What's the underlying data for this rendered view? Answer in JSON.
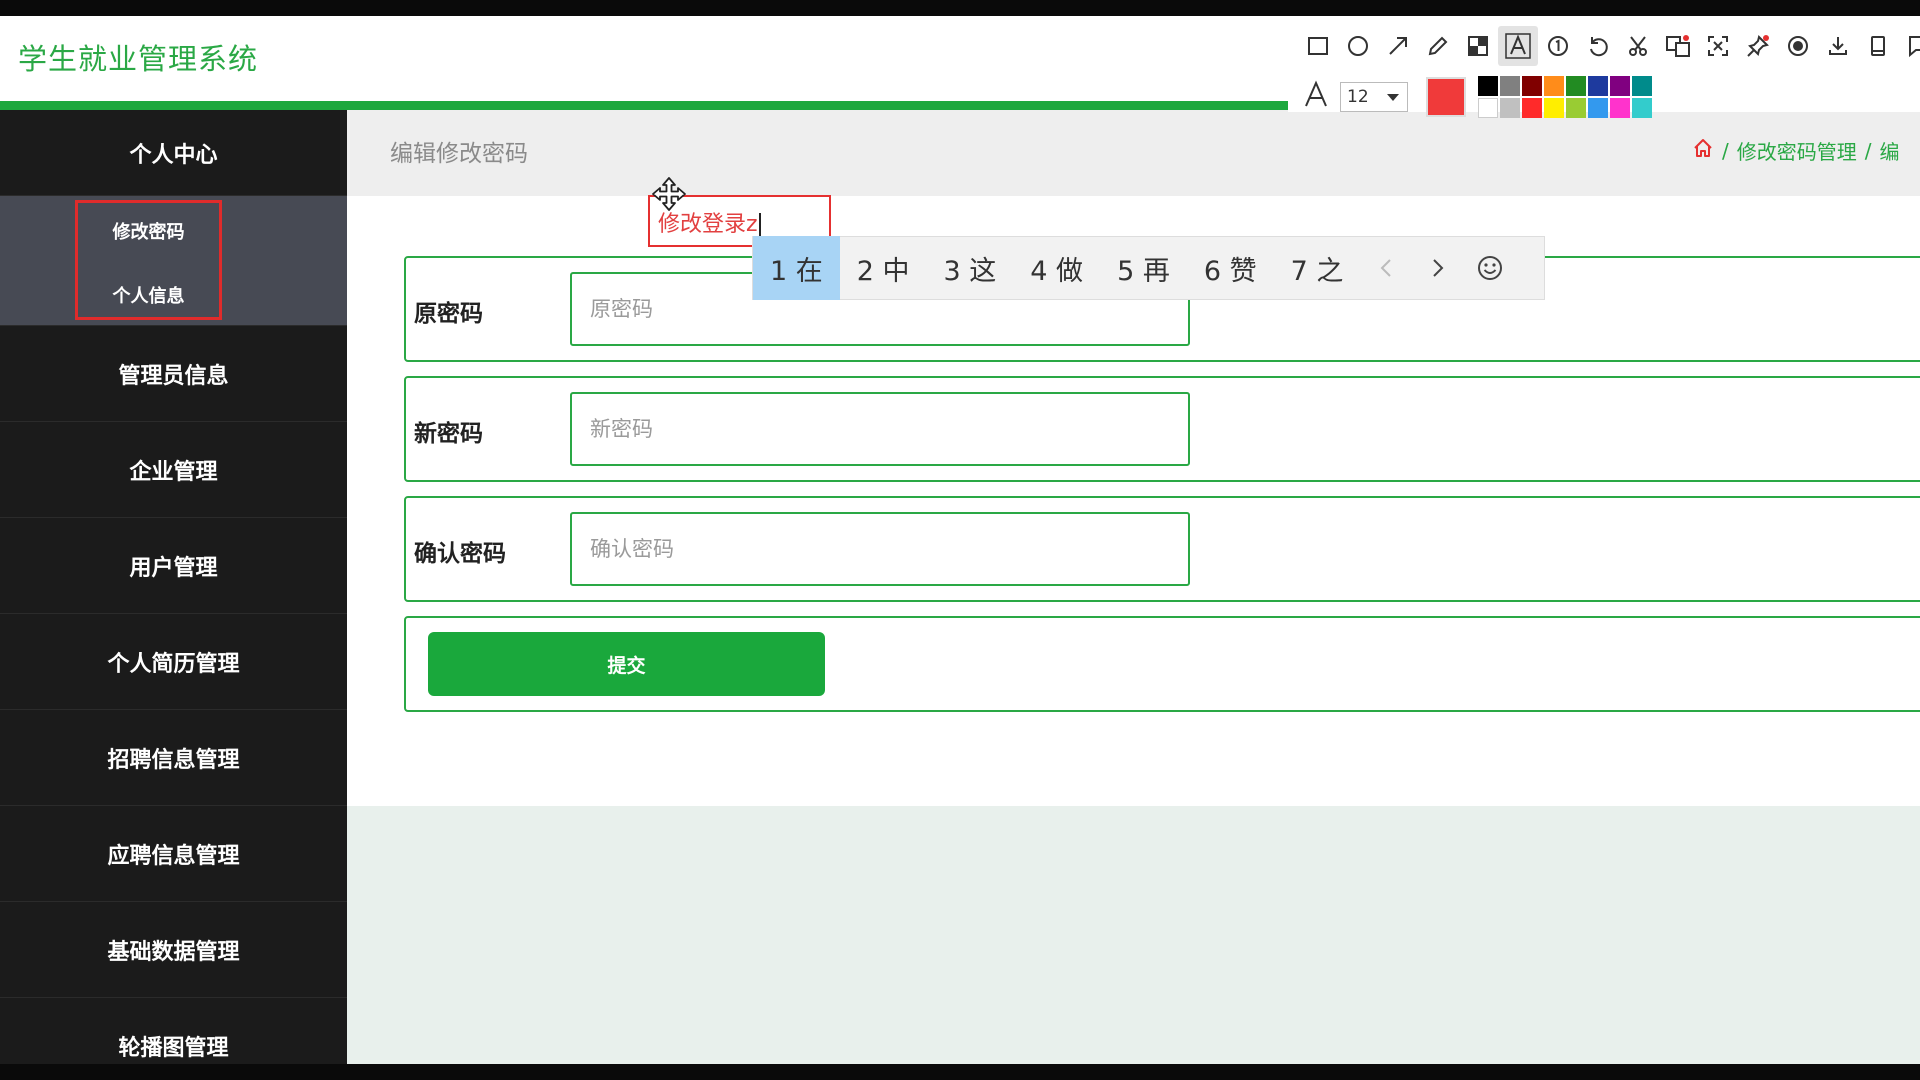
{
  "app": {
    "title": "学生就业管理系统"
  },
  "sidebar": {
    "top_item": "个人中心",
    "sub_items": [
      "修改密码",
      "个人信息"
    ],
    "items": [
      "管理员信息",
      "企业管理",
      "用户管理",
      "个人简历管理",
      "招聘信息管理",
      "应聘信息管理",
      "基础数据管理",
      "轮播图管理"
    ]
  },
  "breadcrumb": {
    "page_title": "编辑修改密码",
    "crumbs": [
      "修改密码管理",
      "编"
    ]
  },
  "form": {
    "fields": [
      {
        "label": "原密码",
        "placeholder": "原密码"
      },
      {
        "label": "新密码",
        "placeholder": "新密码"
      },
      {
        "label": "确认密码",
        "placeholder": "确认密码"
      }
    ],
    "submit_label": "提交"
  },
  "annotation": {
    "text": "修改登录z",
    "color": "#e24040"
  },
  "ime": {
    "candidates": [
      "1 在",
      "2 中",
      "3 这",
      "4 做",
      "5 再",
      "6 赞",
      "7 之"
    ]
  },
  "toolbar": {
    "tools": [
      "rectangle-icon",
      "circle-icon",
      "arrow-icon",
      "pencil-icon",
      "mosaic-icon",
      "text-icon",
      "number-marker-icon",
      "undo-icon",
      "cut-icon",
      "translate-icon",
      "ocr-icon",
      "pin-icon",
      "record-icon",
      "download-icon",
      "device-icon",
      "flag-icon"
    ],
    "font_size": "12",
    "current_color": "#f03a3a",
    "palette": [
      "#000000",
      "#808080",
      "#800000",
      "#ff8c1a",
      "#228b22",
      "#1e3a9e",
      "#800080",
      "#008b8b",
      "#ffffff",
      "#c0c0c0",
      "#ff2a2a",
      "#ffee00",
      "#99cc33",
      "#3399ee",
      "#ff33cc",
      "#33cccc"
    ]
  },
  "colors": {
    "brand_green": "#1da83e",
    "sidebar_bg": "#1b1b1b",
    "highlight_red": "#e02b2b"
  }
}
